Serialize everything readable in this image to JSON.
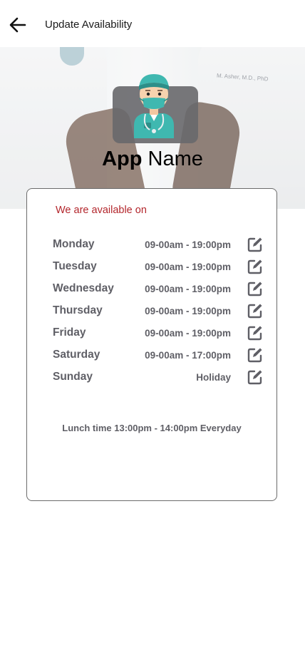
{
  "header": {
    "title": "Update Availability",
    "back_icon": "arrow-left-icon"
  },
  "hero": {
    "background_image": "doctor-holding-phone-photo",
    "logo_icon": "doctor-avatar-icon",
    "app_name_bold": "App",
    "app_name_regular": "Name",
    "badge_text": "M. Asher, M.D., PhD"
  },
  "availability": {
    "label": "We are available on",
    "label_color": "#b3262c",
    "schedule": [
      {
        "day": "Monday",
        "hours": "09-00am - 19:00pm"
      },
      {
        "day": "Tuesday",
        "hours": "09-00am - 19:00pm"
      },
      {
        "day": "Wednesday",
        "hours": "09-00am - 19:00pm"
      },
      {
        "day": "Thursday",
        "hours": "09-00am - 19:00pm"
      },
      {
        "day": "Friday",
        "hours": "09-00am - 19:00pm"
      },
      {
        "day": "Saturday",
        "hours": "09-00am - 17:00pm"
      },
      {
        "day": "Sunday",
        "hours": "Holiday"
      }
    ],
    "edit_icon": "edit-icon",
    "lunch_note": "Lunch time 13:00pm - 14:00pm Everyday"
  }
}
